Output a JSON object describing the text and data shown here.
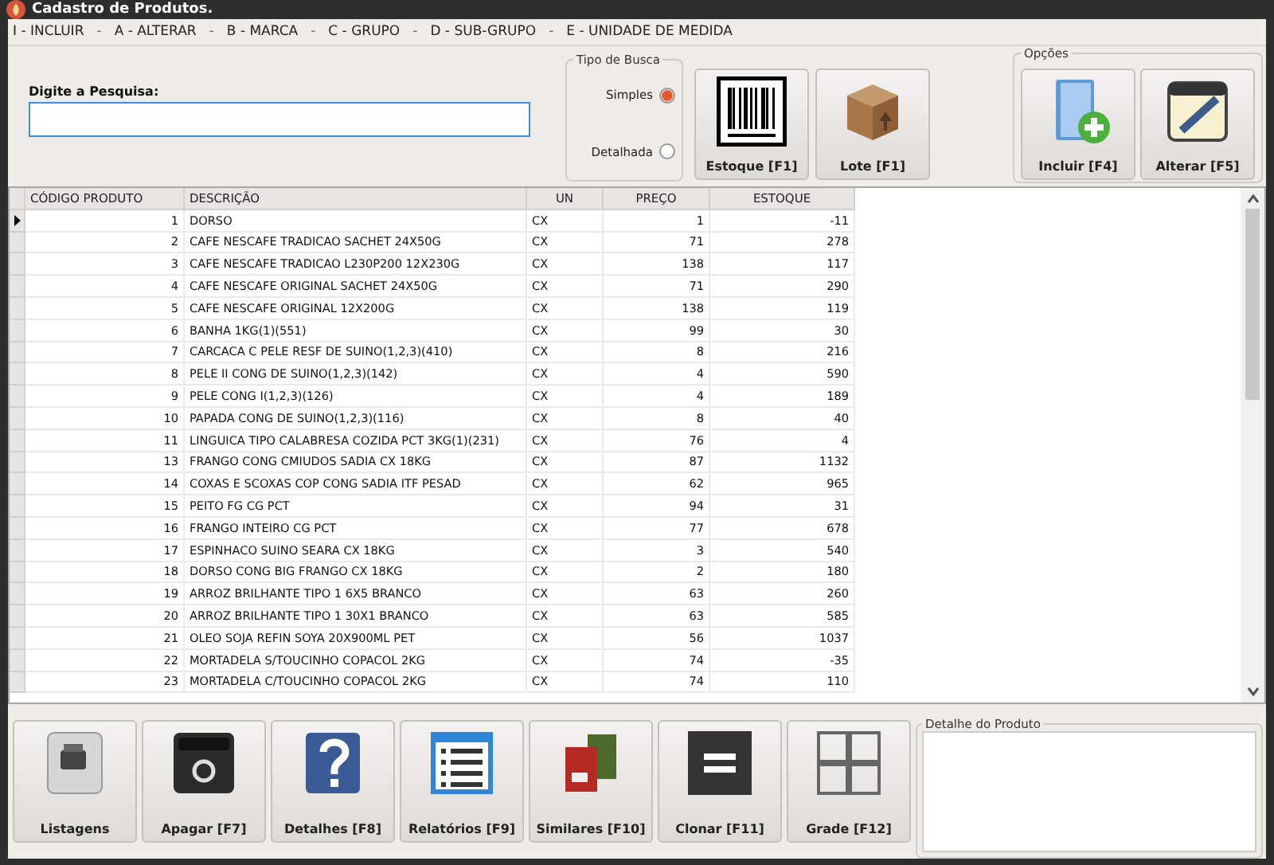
{
  "window": {
    "title": "Cadastro de Produtos."
  },
  "menu": [
    {
      "kind": "item",
      "label": "I - INCLUIR"
    },
    {
      "kind": "separator",
      "label": "-"
    },
    {
      "kind": "item",
      "label": "A - ALTERAR"
    },
    {
      "kind": "separator",
      "label": "-"
    },
    {
      "kind": "item",
      "label": "B - MARCA"
    },
    {
      "kind": "separator",
      "label": "-"
    },
    {
      "kind": "item",
      "label": "C - GRUPO"
    },
    {
      "kind": "separator",
      "label": "-"
    },
    {
      "kind": "item",
      "label": "D - SUB-GRUPO"
    },
    {
      "kind": "separator",
      "label": "-"
    },
    {
      "kind": "item",
      "label": "E - UNIDADE DE MEDIDA"
    }
  ],
  "search": {
    "label": "Digite a Pesquisa:"
  },
  "search_type": {
    "title": "Tipo de Busca",
    "options": [
      {
        "label": "Simples",
        "selected": true
      },
      {
        "label": "Detalhada",
        "selected": false
      }
    ]
  },
  "top_buttons": [
    {
      "kind": "barcode",
      "label": "Estoque [F1]"
    },
    {
      "kind": "box",
      "label": "Lote [F1]"
    }
  ],
  "options": {
    "title": "Opções",
    "buttons": [
      {
        "kind": "add",
        "label": "Incluir [F4]"
      },
      {
        "kind": "notepad",
        "label": "Alterar [F5]"
      }
    ]
  },
  "table": {
    "columns": [
      "CÓDIGO PRODUTO",
      "DESCRIÇÃO",
      "UN",
      "PREÇO",
      "ESTOQUE"
    ],
    "rows": [
      {
        "selected": true,
        "cells": [
          "1",
          "DORSO",
          "CX",
          "1",
          "-11"
        ]
      },
      {
        "selected": false,
        "cells": [
          "2",
          "CAFE NESCAFE TRADICAO SACHET 24X50G",
          "CX",
          "71",
          "278"
        ]
      },
      {
        "selected": false,
        "cells": [
          "3",
          "CAFE NESCAFE TRADICAO L230P200 12X230G",
          "CX",
          "138",
          "117"
        ]
      },
      {
        "selected": false,
        "cells": [
          "4",
          "CAFE NESCAFE ORIGINAL SACHET 24X50G",
          "CX",
          "71",
          "290"
        ]
      },
      {
        "selected": false,
        "cells": [
          "5",
          "CAFE NESCAFE ORIGINAL 12X200G",
          "CX",
          "138",
          "119"
        ]
      },
      {
        "selected": false,
        "cells": [
          "6",
          "BANHA 1KG(1)(551)",
          "CX",
          "99",
          "30"
        ]
      },
      {
        "selected": false,
        "cells": [
          "7",
          "CARCACA C PELE RESF DE SUINO(1,2,3)(410)",
          "CX",
          "8",
          "216"
        ]
      },
      {
        "selected": false,
        "cells": [
          "8",
          "PELE II CONG DE SUINO(1,2,3)(142)",
          "CX",
          "4",
          "590"
        ]
      },
      {
        "selected": false,
        "cells": [
          "9",
          "PELE CONG I(1,2,3)(126)",
          "CX",
          "4",
          "189"
        ]
      },
      {
        "selected": false,
        "cells": [
          "10",
          "PAPADA CONG DE SUINO(1,2,3)(116)",
          "CX",
          "8",
          "40"
        ]
      },
      {
        "selected": false,
        "cells": [
          "11",
          "LINGUICA TIPO CALABRESA COZIDA PCT 3KG(1)(231)",
          "CX",
          "76",
          "4"
        ]
      },
      {
        "selected": false,
        "cells": [
          "13",
          "FRANGO CONG CMIUDOS SADIA CX 18KG",
          "CX",
          "87",
          "1132"
        ]
      },
      {
        "selected": false,
        "cells": [
          "14",
          "COXAS E SCOXAS COP CONG SADIA ITF PESAD",
          "CX",
          "62",
          "965"
        ]
      },
      {
        "selected": false,
        "cells": [
          "15",
          "PEITO FG CG PCT",
          "CX",
          "94",
          "31"
        ]
      },
      {
        "selected": false,
        "cells": [
          "16",
          "FRANGO INTEIRO CG PCT",
          "CX",
          "77",
          "678"
        ]
      },
      {
        "selected": false,
        "cells": [
          "17",
          "ESPINHACO SUINO SEARA CX 18KG",
          "CX",
          "3",
          "540"
        ]
      },
      {
        "selected": false,
        "cells": [
          "18",
          "DORSO CONG BIG FRANGO CX 18KG",
          "CX",
          "2",
          "180"
        ]
      },
      {
        "selected": false,
        "cells": [
          "19",
          "ARROZ BRILHANTE TIPO 1 6X5 BRANCO",
          "CX",
          "63",
          "260"
        ]
      },
      {
        "selected": false,
        "cells": [
          "20",
          "ARROZ BRILHANTE TIPO 1 30X1 BRANCO",
          "CX",
          "63",
          "585"
        ]
      },
      {
        "selected": false,
        "cells": [
          "21",
          "OLEO SOJA REFIN SOYA 20X900ML PET",
          "CX",
          "56",
          "1037"
        ]
      },
      {
        "selected": false,
        "cells": [
          "22",
          "MORTADELA S/TOUCINHO COPACOL 2KG",
          "CX",
          "74",
          "-35"
        ]
      },
      {
        "selected": false,
        "cells": [
          "23",
          "MORTADELA C/TOUCINHO COPACOL 2KG",
          "CX",
          "74",
          "110"
        ]
      }
    ]
  },
  "bottom_buttons": [
    {
      "kind": "printer",
      "label": "Listagens"
    },
    {
      "kind": "trash",
      "label": "Apagar [F7]"
    },
    {
      "kind": "help",
      "label": "Detalhes [F8]"
    },
    {
      "kind": "list",
      "label": "Relatórios [F9]"
    },
    {
      "kind": "books",
      "label": "Similares [F10]"
    },
    {
      "kind": "equals",
      "label": "Clonar [F11]"
    },
    {
      "kind": "grid",
      "label": "Grade [F12]"
    }
  ],
  "detail": {
    "title": "Detalhe do Produto"
  }
}
